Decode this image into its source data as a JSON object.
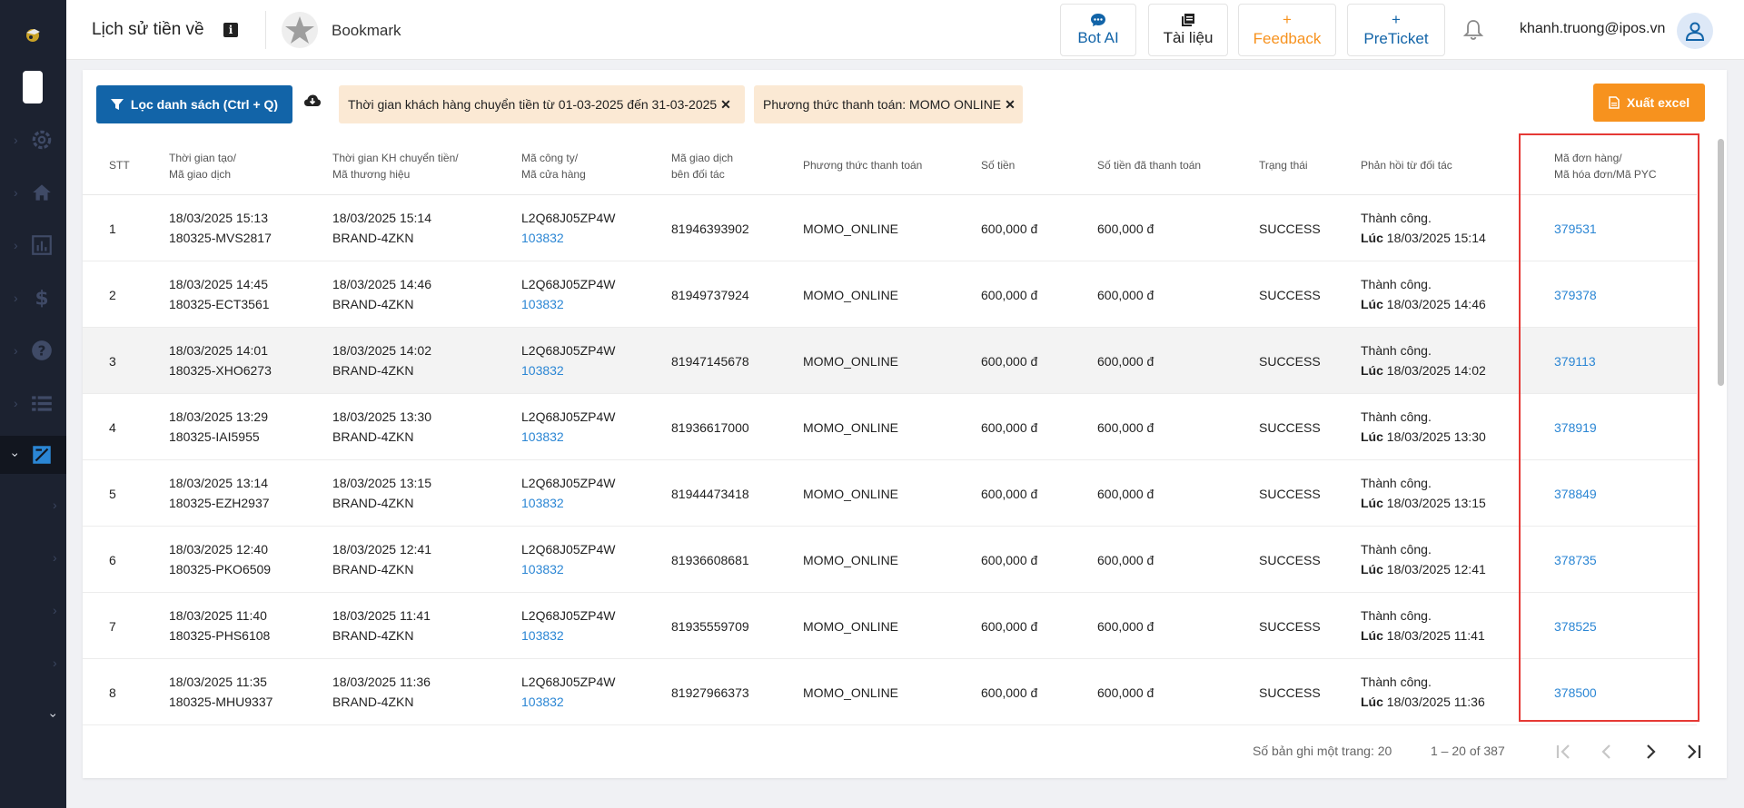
{
  "header": {
    "title": "Lịch sử tiền về",
    "info_icon": "i",
    "bookmark_label": "Bookmark",
    "buttons": {
      "bot_ai": "Bot AI",
      "docs": "Tài liệu",
      "feedback": "Feedback",
      "preticket": "PreTicket"
    },
    "user_email": "khanh.truong@ipos.vn"
  },
  "toolbar": {
    "filter_label": "Lọc danh sách (Ctrl + Q)",
    "chip_time": "Thời gian khách hàng chuyển tiền từ 01-03-2025 đến 31-03-2025",
    "chip_method": "Phương thức thanh toán: MOMO ONLINE",
    "chip_close": "✕",
    "export_label": "Xuất excel"
  },
  "table": {
    "headers": {
      "stt": "STT",
      "created_1": "Thời gian tạo/",
      "created_2": "Mã giao dịch",
      "transfer_1": "Thời gian KH chuyển tiền/",
      "transfer_2": "Mã thương hiệu",
      "company_1": "Mã công ty/",
      "company_2": "Mã cửa hàng",
      "partner_1": "Mã giao dịch",
      "partner_2": "bên đối tác",
      "method": "Phương thức thanh toán",
      "amount": "Số tiền",
      "paid": "Số tiền đã thanh toán",
      "status": "Trạng thái",
      "response": "Phản hồi từ đối tác",
      "order_1": "Mã đơn hàng/",
      "order_2": "Mã hóa đơn/Mã PYC"
    },
    "rows": [
      {
        "stt": "1",
        "created": "18/03/2025 15:13",
        "txn": "180325-MVS2817",
        "transfer": "18/03/2025 15:14",
        "brand": "BRAND-4ZKN",
        "company": "L2Q68J05ZP4W",
        "store": "103832",
        "partner_txn": "81946393902",
        "method": "MOMO_ONLINE",
        "amount": "600,000 đ",
        "paid": "600,000 đ",
        "status": "SUCCESS",
        "resp": "Thành công.",
        "resp_prefix": "Lúc",
        "resp_time": " 18/03/2025 15:14",
        "order": "379531"
      },
      {
        "stt": "2",
        "created": "18/03/2025 14:45",
        "txn": "180325-ECT3561",
        "transfer": "18/03/2025 14:46",
        "brand": "BRAND-4ZKN",
        "company": "L2Q68J05ZP4W",
        "store": "103832",
        "partner_txn": "81949737924",
        "method": "MOMO_ONLINE",
        "amount": "600,000 đ",
        "paid": "600,000 đ",
        "status": "SUCCESS",
        "resp": "Thành công.",
        "resp_prefix": "Lúc",
        "resp_time": " 18/03/2025 14:46",
        "order": "379378"
      },
      {
        "stt": "3",
        "created": "18/03/2025 14:01",
        "txn": "180325-XHO6273",
        "transfer": "18/03/2025 14:02",
        "brand": "BRAND-4ZKN",
        "company": "L2Q68J05ZP4W",
        "store": "103832",
        "partner_txn": "81947145678",
        "method": "MOMO_ONLINE",
        "amount": "600,000 đ",
        "paid": "600,000 đ",
        "status": "SUCCESS",
        "resp": "Thành công.",
        "resp_prefix": "Lúc",
        "resp_time": " 18/03/2025 14:02",
        "order": "379113"
      },
      {
        "stt": "4",
        "created": "18/03/2025 13:29",
        "txn": "180325-IAI5955",
        "transfer": "18/03/2025 13:30",
        "brand": "BRAND-4ZKN",
        "company": "L2Q68J05ZP4W",
        "store": "103832",
        "partner_txn": "81936617000",
        "method": "MOMO_ONLINE",
        "amount": "600,000 đ",
        "paid": "600,000 đ",
        "status": "SUCCESS",
        "resp": "Thành công.",
        "resp_prefix": "Lúc",
        "resp_time": " 18/03/2025 13:30",
        "order": "378919"
      },
      {
        "stt": "5",
        "created": "18/03/2025 13:14",
        "txn": "180325-EZH2937",
        "transfer": "18/03/2025 13:15",
        "brand": "BRAND-4ZKN",
        "company": "L2Q68J05ZP4W",
        "store": "103832",
        "partner_txn": "81944473418",
        "method": "MOMO_ONLINE",
        "amount": "600,000 đ",
        "paid": "600,000 đ",
        "status": "SUCCESS",
        "resp": "Thành công.",
        "resp_prefix": "Lúc",
        "resp_time": " 18/03/2025 13:15",
        "order": "378849"
      },
      {
        "stt": "6",
        "created": "18/03/2025 12:40",
        "txn": "180325-PKO6509",
        "transfer": "18/03/2025 12:41",
        "brand": "BRAND-4ZKN",
        "company": "L2Q68J05ZP4W",
        "store": "103832",
        "partner_txn": "81936608681",
        "method": "MOMO_ONLINE",
        "amount": "600,000 đ",
        "paid": "600,000 đ",
        "status": "SUCCESS",
        "resp": "Thành công.",
        "resp_prefix": "Lúc",
        "resp_time": " 18/03/2025 12:41",
        "order": "378735"
      },
      {
        "stt": "7",
        "created": "18/03/2025 11:40",
        "txn": "180325-PHS6108",
        "transfer": "18/03/2025 11:41",
        "brand": "BRAND-4ZKN",
        "company": "L2Q68J05ZP4W",
        "store": "103832",
        "partner_txn": "81935559709",
        "method": "MOMO_ONLINE",
        "amount": "600,000 đ",
        "paid": "600,000 đ",
        "status": "SUCCESS",
        "resp": "Thành công.",
        "resp_prefix": "Lúc",
        "resp_time": " 18/03/2025 11:41",
        "order": "378525"
      },
      {
        "stt": "8",
        "created": "18/03/2025 11:35",
        "txn": "180325-MHU9337",
        "transfer": "18/03/2025 11:36",
        "brand": "BRAND-4ZKN",
        "company": "L2Q68J05ZP4W",
        "store": "103832",
        "partner_txn": "81927966373",
        "method": "MOMO_ONLINE",
        "amount": "600,000 đ",
        "paid": "600,000 đ",
        "status": "SUCCESS",
        "resp": "Thành công.",
        "resp_prefix": "Lúc",
        "resp_time": " 18/03/2025 11:36",
        "order": "378500"
      }
    ]
  },
  "footer": {
    "per_page_label": "Số bản ghi một trang: 20",
    "range_label": "1 – 20 of 387"
  },
  "colors": {
    "primary": "#1264a8",
    "accent_orange": "#f7921e",
    "link_blue": "#2b86d4",
    "highlight_red": "#e53935",
    "sidebar_bg": "#1c2230"
  },
  "icons": {
    "sidebar": [
      "settings-icon",
      "home-icon",
      "chart-icon",
      "dollar-icon",
      "help-icon",
      "list-icon",
      "report-icon"
    ]
  }
}
